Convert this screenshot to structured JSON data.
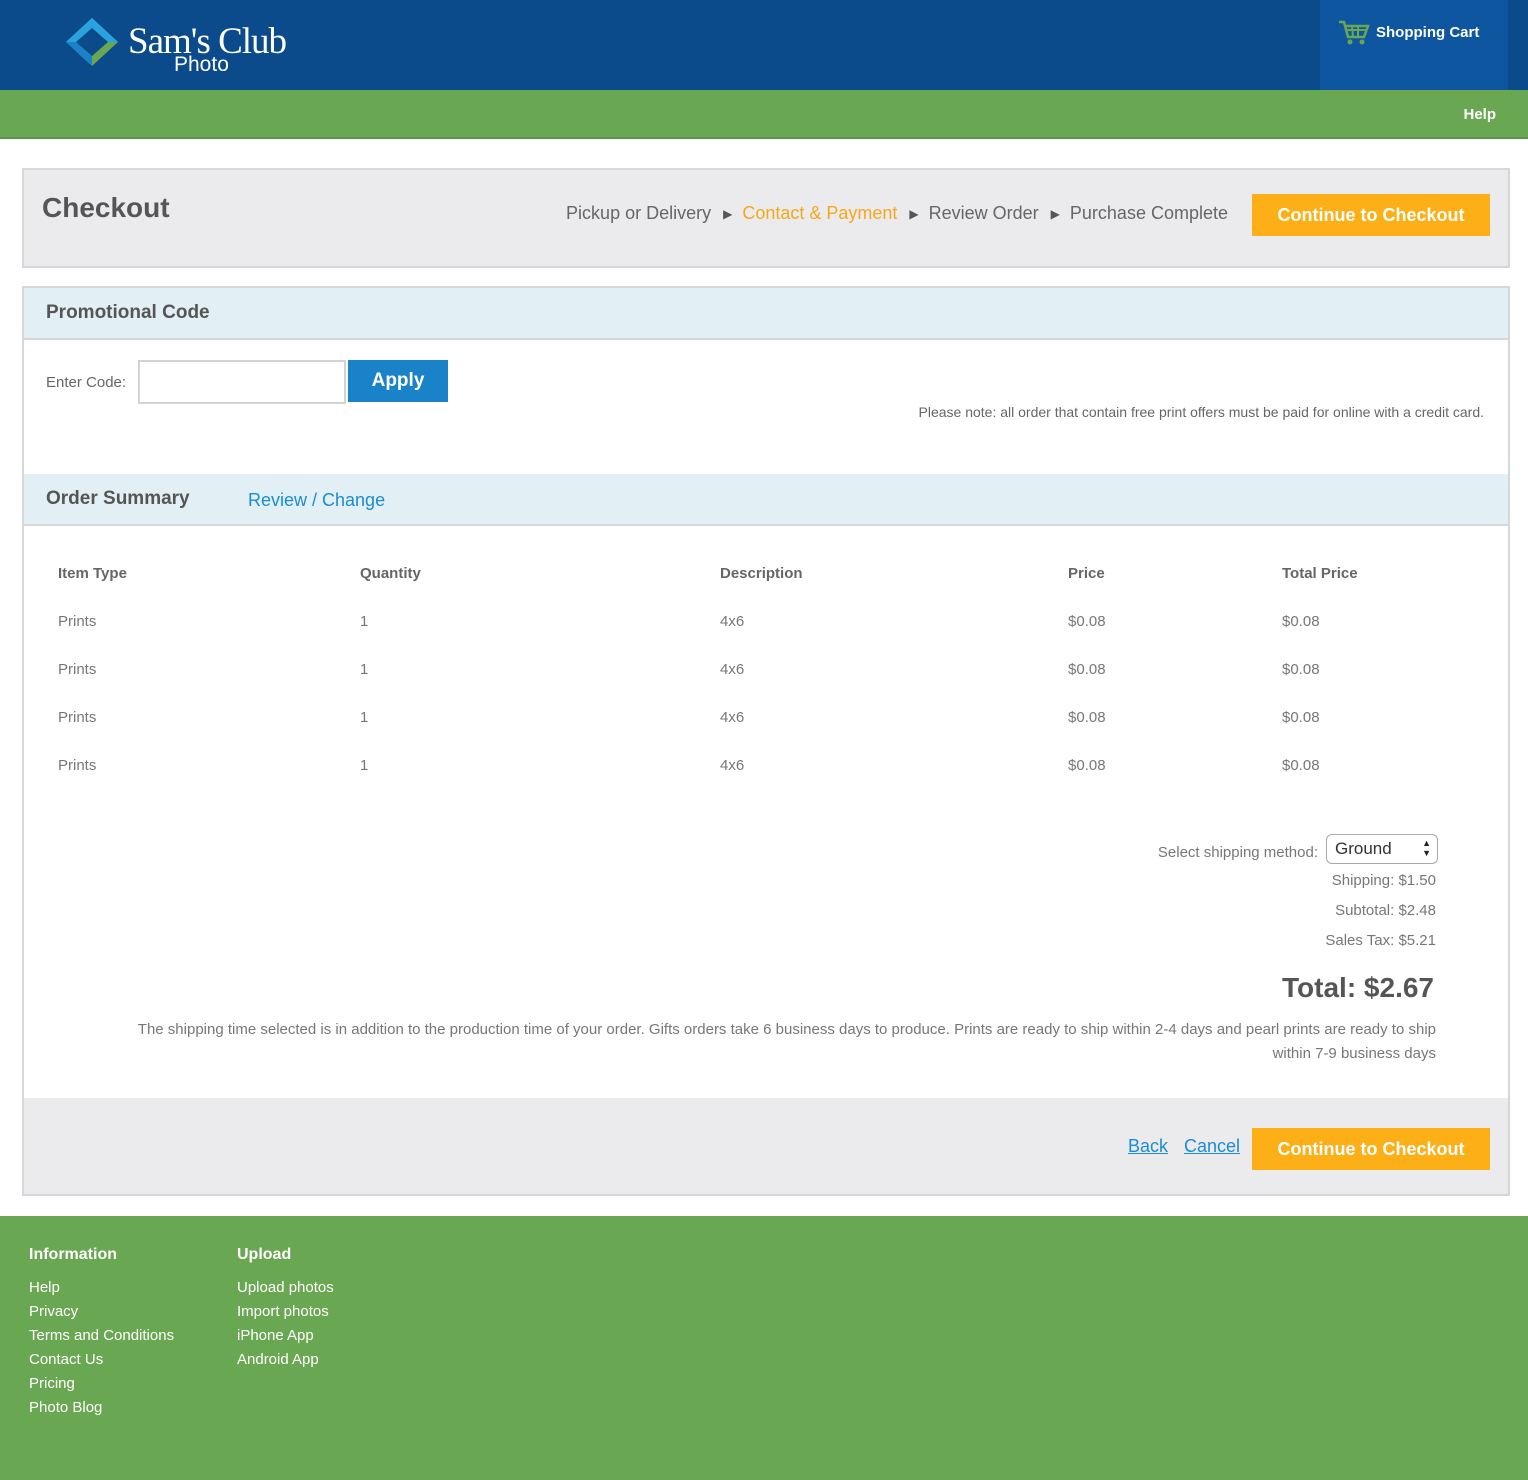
{
  "header": {
    "brand": "Sam's Club",
    "brand_sub": "Photo",
    "cart_label": "Shopping Cart",
    "help_label": "Help",
    "colors": {
      "blue": "#0b4a8b",
      "green": "#6aa752",
      "orange": "#fcaf17",
      "link": "#1a8cd0"
    },
    "cart_icon": "shopping-cart-icon"
  },
  "checkout": {
    "title": "Checkout",
    "steps": [
      {
        "label": "Pickup or Delivery"
      },
      {
        "label": "Contact & Payment"
      },
      {
        "label": "Review Order"
      },
      {
        "label": "Purchase Complete"
      }
    ],
    "active_step": "Contact & Payment",
    "continue_label": "Continue to Checkout"
  },
  "promo": {
    "heading": "Promotional Code",
    "code_label": "Enter Code:",
    "code_value": "",
    "apply_label": "Apply",
    "note": "Please note: all order that contain free print offers must be paid for online with a credit card."
  },
  "summary": {
    "heading": "Order Summary",
    "review_link": "Review / Change",
    "columns": [
      "Item Type",
      "Quantity",
      "Description",
      "Price",
      "Total Price"
    ],
    "rows": [
      [
        "Prints",
        "1",
        "4x6",
        "$0.08",
        "$0.08"
      ],
      [
        "Prints",
        "1",
        "4x6",
        "$0.08",
        "$0.08"
      ],
      [
        "Prints",
        "1",
        "4x6",
        "$0.08",
        "$0.08"
      ],
      [
        "Prints",
        "1",
        "4x6",
        "$0.08",
        "$0.08"
      ]
    ],
    "shipping_method_label": "Select shipping method:",
    "shipping_method_value": "Ground",
    "shipping": "Shipping: $1.50",
    "subtotal": "Subtotal: $2.48",
    "sales_tax": "Sales Tax: $5.21",
    "total": "Total: $2.67",
    "shipping_note": "The shipping time selected is in addition to the production time of your order. Gifts orders take 6 business days to produce. Prints are ready to ship within 2-4 days and pearl prints are ready to ship within 7-9 business days"
  },
  "actions": {
    "back": "Back",
    "cancel": "Cancel",
    "continue": "Continue to Checkout"
  },
  "footer": {
    "information": {
      "heading": "Information",
      "links": [
        "Help",
        "Privacy",
        "Terms and Conditions",
        "Contact Us",
        "Pricing",
        "Photo Blog"
      ]
    },
    "upload": {
      "heading": "Upload",
      "links": [
        "Upload photos",
        "Import photos",
        "iPhone App",
        "Android App"
      ]
    }
  }
}
